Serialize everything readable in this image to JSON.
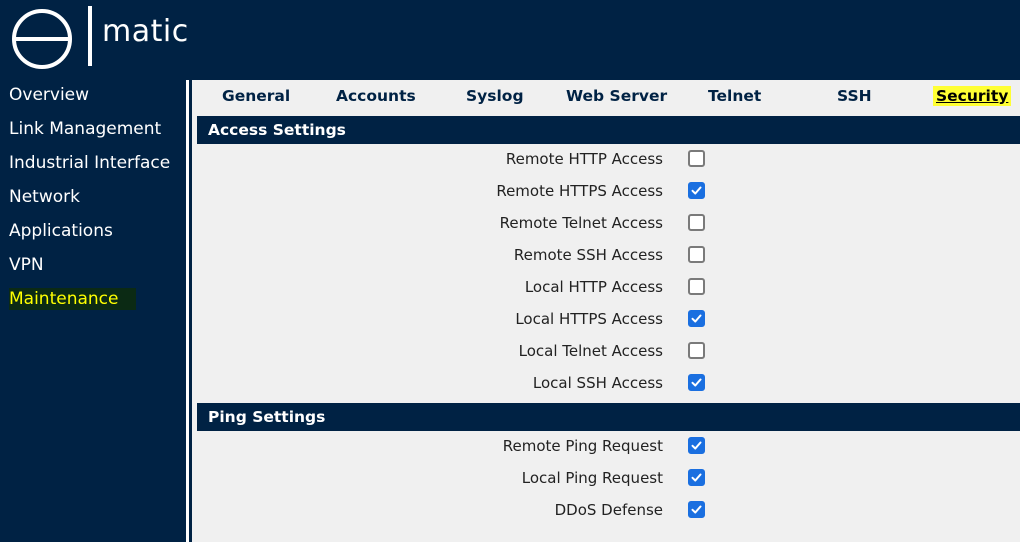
{
  "brand": {
    "name": "matic"
  },
  "sidebar": {
    "items": [
      {
        "label": "Overview",
        "active": false
      },
      {
        "label": "Link Management",
        "active": false
      },
      {
        "label": "Industrial Interface",
        "active": false
      },
      {
        "label": "Network",
        "active": false
      },
      {
        "label": "Applications",
        "active": false
      },
      {
        "label": "VPN",
        "active": false
      },
      {
        "label": "Maintenance",
        "active": true
      }
    ]
  },
  "tabs": [
    {
      "label": "General",
      "active": false
    },
    {
      "label": "Accounts",
      "active": false
    },
    {
      "label": "Syslog",
      "active": false
    },
    {
      "label": "Web Server",
      "active": false
    },
    {
      "label": "Telnet",
      "active": false
    },
    {
      "label": "SSH",
      "active": false
    },
    {
      "label": "Security",
      "active": true
    }
  ],
  "access_settings": {
    "title": "Access Settings",
    "rows": [
      {
        "label": "Remote HTTP Access",
        "checked": false
      },
      {
        "label": "Remote HTTPS Access",
        "checked": true
      },
      {
        "label": "Remote Telnet Access",
        "checked": false
      },
      {
        "label": "Remote SSH Access",
        "checked": false
      },
      {
        "label": "Local HTTP Access",
        "checked": false
      },
      {
        "label": "Local HTTPS Access",
        "checked": true
      },
      {
        "label": "Local Telnet Access",
        "checked": false
      },
      {
        "label": "Local SSH Access",
        "checked": true
      }
    ]
  },
  "ping_settings": {
    "title": "Ping Settings",
    "rows": [
      {
        "label": "Remote Ping Request",
        "checked": true
      },
      {
        "label": "Local Ping Request",
        "checked": true
      },
      {
        "label": "DDoS Defense",
        "checked": true
      }
    ]
  },
  "colors": {
    "navy": "#002244",
    "highlight": "#ffff00",
    "checkbox_on": "#1a6fe0"
  },
  "icons": {
    "logo": "e-logo-icon",
    "checkmark": "checkmark-icon"
  }
}
